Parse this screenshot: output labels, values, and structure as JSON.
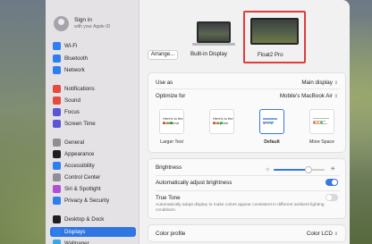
{
  "account": {
    "title": "Sign in",
    "subtitle": "with your Apple ID"
  },
  "sidebar": {
    "items": [
      {
        "label": "Wi-Fi",
        "icon": "wifi-icon",
        "color": "#2f7ef0"
      },
      {
        "label": "Bluetooth",
        "icon": "bluetooth-icon",
        "color": "#2f7ef0"
      },
      {
        "label": "Network",
        "icon": "network-icon",
        "color": "#2f7ef0"
      },
      {
        "label": "Notifications",
        "icon": "notifications-icon",
        "color": "#e8493f"
      },
      {
        "label": "Sound",
        "icon": "sound-icon",
        "color": "#e8493f"
      },
      {
        "label": "Focus",
        "icon": "focus-icon",
        "color": "#5a55d6"
      },
      {
        "label": "Screen Time",
        "icon": "screen-time-icon",
        "color": "#5a55d6"
      },
      {
        "label": "General",
        "icon": "gear-icon",
        "color": "#8e8e93"
      },
      {
        "label": "Appearance",
        "icon": "appearance-icon",
        "color": "#1e1e1e"
      },
      {
        "label": "Accessibility",
        "icon": "accessibility-icon",
        "color": "#2f7ef0"
      },
      {
        "label": "Control Center",
        "icon": "control-center-icon",
        "color": "#8e8e93"
      },
      {
        "label": "Siri & Spotlight",
        "icon": "siri-icon",
        "color": "#b04fd6"
      },
      {
        "label": "Privacy & Security",
        "icon": "hand-icon",
        "color": "#2f7ef0"
      },
      {
        "label": "Desktop & Dock",
        "icon": "desktop-dock-icon",
        "color": "#1e1e1e"
      },
      {
        "label": "Displays",
        "icon": "displays-icon",
        "color": "#2f7ef0",
        "selected": true
      },
      {
        "label": "Wallpaper",
        "icon": "wallpaper-icon",
        "color": "#38a7e6"
      }
    ]
  },
  "displays": {
    "arrange_label": "Arrange...",
    "builtin_label": "Built-in Display",
    "float_label": "Float2 Pro"
  },
  "settings": {
    "use_as_label": "Use as",
    "use_as_value": "Main display",
    "optimize_label": "Optimize for",
    "optimize_value": "Mobile's MacBook Air",
    "resolution_options": [
      {
        "label": "Larger Text",
        "preview": "Here's to the troublema"
      },
      {
        "label": "",
        "preview": "Here's to the crazy one"
      },
      {
        "label": "Default",
        "preview": "",
        "selected": true
      },
      {
        "label": "More Space",
        "preview": ""
      }
    ],
    "brightness_label": "Brightness",
    "brightness_level": 0.68,
    "auto_brightness_label": "Automatically adjust brightness",
    "auto_brightness_on": true,
    "true_tone_label": "True Tone",
    "true_tone_desc": "Automatically adapt display to make colors appear consistent in different ambient lighting conditions.",
    "true_tone_on": false,
    "color_profile_label": "Color profile",
    "color_profile_value": "Color LCD"
  },
  "colors": {
    "accent": "#3378e5",
    "highlight_border": "#e23b3b"
  }
}
